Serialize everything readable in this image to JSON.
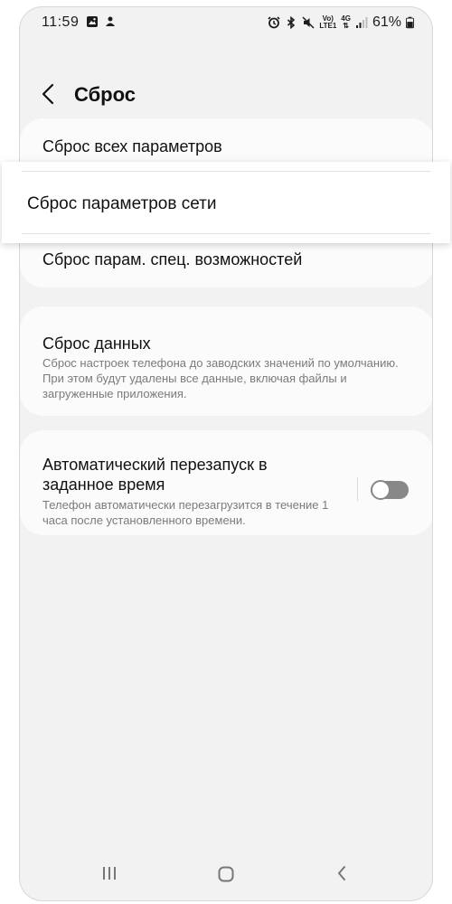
{
  "status_bar": {
    "time": "11:59",
    "network_top": "Vo)",
    "network_bottom": "LTE1",
    "network_4g": "4G",
    "battery": "61%"
  },
  "header": {
    "title": "Сброс"
  },
  "reset_options": {
    "all_settings": "Сброс всех параметров",
    "network_settings": "Сброс параметров сети",
    "accessibility": "Сброс парам. спец. возможностей"
  },
  "factory_reset": {
    "title": "Сброс данных",
    "description": "Сброс настроек телефона до заводских значений по умолчанию. При этом будут удалены все данные, включая файлы и загруженные приложения."
  },
  "auto_restart": {
    "title": "Автоматический перезапуск в заданное время",
    "description": "Телефон автоматически перезагрузится в течение 1 часа после установленного времени.",
    "enabled": false
  },
  "colors": {
    "background": "#f2f2f2",
    "card": "#fbfbfb",
    "toggle_off": "#888888"
  }
}
